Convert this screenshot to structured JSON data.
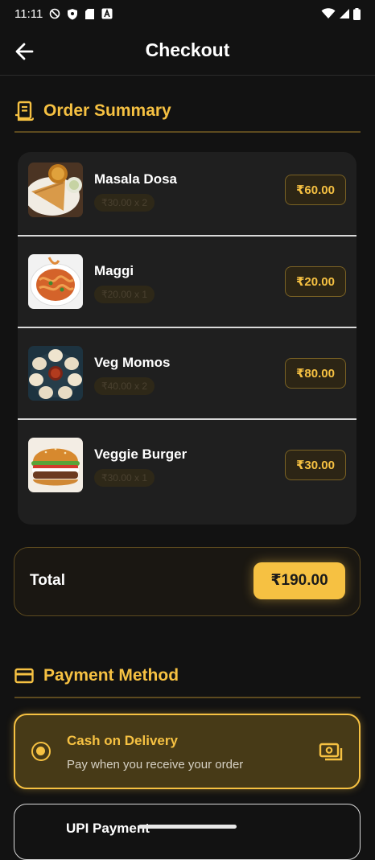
{
  "status_bar": {
    "time": "11:11"
  },
  "app_bar": {
    "title": "Checkout"
  },
  "order_summary": {
    "title": "Order Summary",
    "items": [
      {
        "name": "Masala Dosa",
        "qty_text": "₹30.00 x 2",
        "price": "₹60.00"
      },
      {
        "name": "Maggi",
        "qty_text": "₹20.00 x 1",
        "price": "₹20.00"
      },
      {
        "name": "Veg Momos",
        "qty_text": "₹40.00 x 2",
        "price": "₹80.00"
      },
      {
        "name": "Veggie Burger",
        "qty_text": "₹30.00 x 1",
        "price": "₹30.00"
      }
    ]
  },
  "total": {
    "label": "Total",
    "amount": "₹190.00"
  },
  "payment": {
    "title": "Payment Method",
    "options": [
      {
        "title": "Cash on Delivery",
        "subtitle": "Pay when you receive your order",
        "selected": true
      },
      {
        "title": "UPI Payment",
        "selected": false
      }
    ]
  },
  "colors": {
    "accent": "#f6c142",
    "background": "#121212",
    "card": "#1f1f1f"
  }
}
